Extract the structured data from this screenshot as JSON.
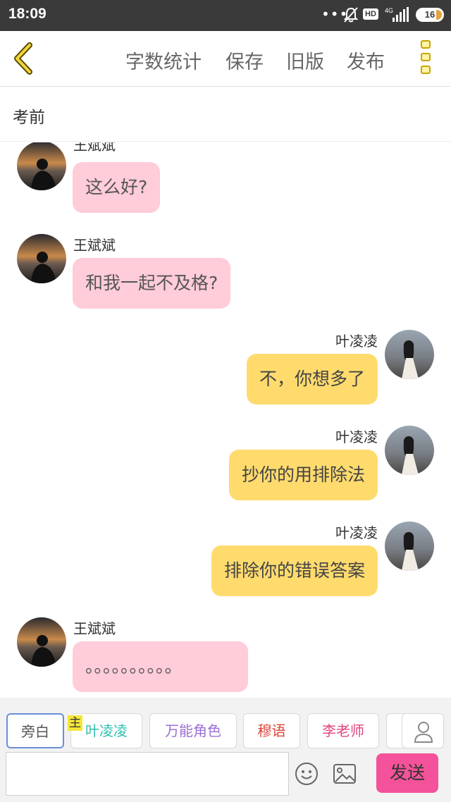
{
  "status_bar": {
    "time": "18:09",
    "dots": "•••",
    "hd": "HD",
    "network": "4G",
    "battery": "16"
  },
  "toolbar": {
    "word_count": "字数统计",
    "save": "保存",
    "old_version": "旧版",
    "publish": "发布"
  },
  "subtitle": "考前",
  "messages": [
    {
      "side": "left",
      "name": "王斌斌",
      "text": "这么好?"
    },
    {
      "side": "left",
      "name": "王斌斌",
      "text": "和我一起不及格?"
    },
    {
      "side": "right",
      "name": "叶凌凌",
      "text": "不，你想多了"
    },
    {
      "side": "right",
      "name": "叶凌凌",
      "text": "抄你的用排除法"
    },
    {
      "side": "right",
      "name": "叶凌凌",
      "text": "排除你的错误答案"
    },
    {
      "side": "left",
      "name": "王斌斌",
      "text": "。。。。。。。。。。"
    }
  ],
  "roles": [
    {
      "label": "旁白",
      "color": "#555555"
    },
    {
      "label": "叶凌凌",
      "color": "#2bbfb0",
      "badge": "主"
    },
    {
      "label": "万能角色",
      "color": "#9b6fd4"
    },
    {
      "label": "穆语",
      "color": "#e0453a"
    },
    {
      "label": "李老师",
      "color": "#e0467f"
    }
  ],
  "input": {
    "placeholder": "",
    "send_label": "发送"
  },
  "colors": {
    "left_bubble": "#ffccd9",
    "right_bubble": "#ffdb6e",
    "send_button": "#f4529a",
    "back_arrow": "#d9b800"
  },
  "icons": [
    "back-icon",
    "more-icon",
    "user-icon",
    "emoji-icon",
    "image-icon"
  ]
}
